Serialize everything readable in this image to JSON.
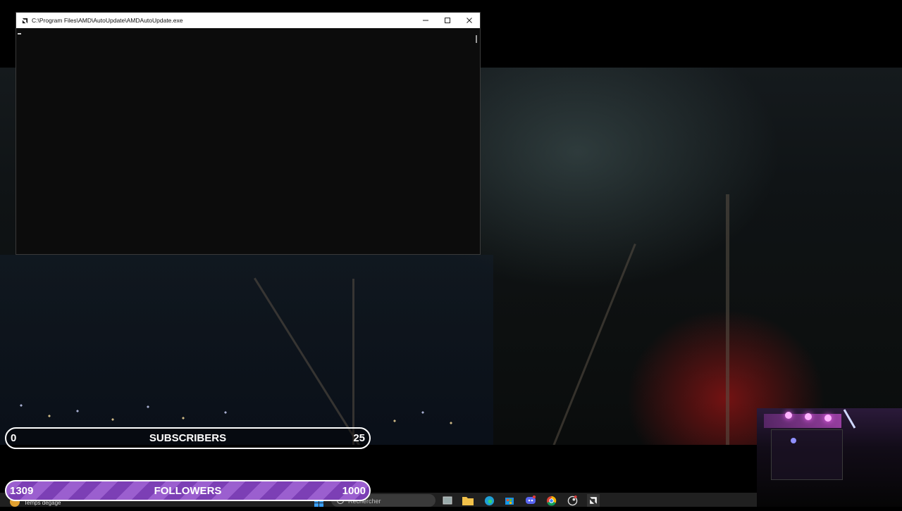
{
  "console_window": {
    "title": "C:\\Program Files\\AMD\\AutoUpdate\\AMDAutoUpdate.exe",
    "minimize_glyph": "—",
    "maximize_glyph": "☐",
    "close_glyph": "✕",
    "icon": "amd-logo-icon"
  },
  "subscribers_bar": {
    "current": "0",
    "label": "SUBSCRIBERS",
    "goal": "25"
  },
  "followers_bar": {
    "current": "1309",
    "label": "FOLLOWERS",
    "goal": "1000",
    "progress_fraction": 1.0,
    "stripe_colors": [
      "#9b5fcf",
      "#7c3fb5"
    ]
  },
  "taskbar": {
    "weather_text": "Temps dégagé",
    "search_placeholder": "Rechercher",
    "pinned_icons": [
      "task-view-icon",
      "file-explorer-icon",
      "edge-icon",
      "store-icon",
      "discord-icon",
      "chrome-icon",
      "steam-icon",
      "amd-software-icon"
    ]
  },
  "colors": {
    "accent_purple": "#8a4fc4"
  }
}
